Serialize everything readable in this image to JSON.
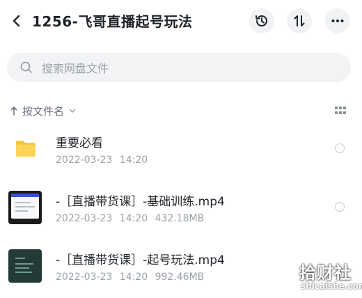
{
  "header": {
    "title": "1256-飞哥直播起号玩法"
  },
  "search": {
    "placeholder": "搜索网盘文件"
  },
  "sort": {
    "label": "按文件名"
  },
  "files": [
    {
      "name": "重要必看",
      "meta": "2022-03-23 14:20",
      "type": "folder"
    },
    {
      "name": "-［直播带货课］-基础训练.mp4",
      "meta": "2022-03-23 14:20 432.18MB",
      "type": "video"
    },
    {
      "name": "-［直播带货课］-起号玩法.mp4",
      "meta": "2022-03-23 14:20 992.46MB",
      "type": "video"
    }
  ],
  "watermark": {
    "brand": "拾财社",
    "domain": "shicaishe.com"
  },
  "colors": {
    "folder": "#f7c53c",
    "background": "#ffffff",
    "search_bg": "#f2f3f5",
    "icon_button_bg": "#f1f2f4"
  }
}
